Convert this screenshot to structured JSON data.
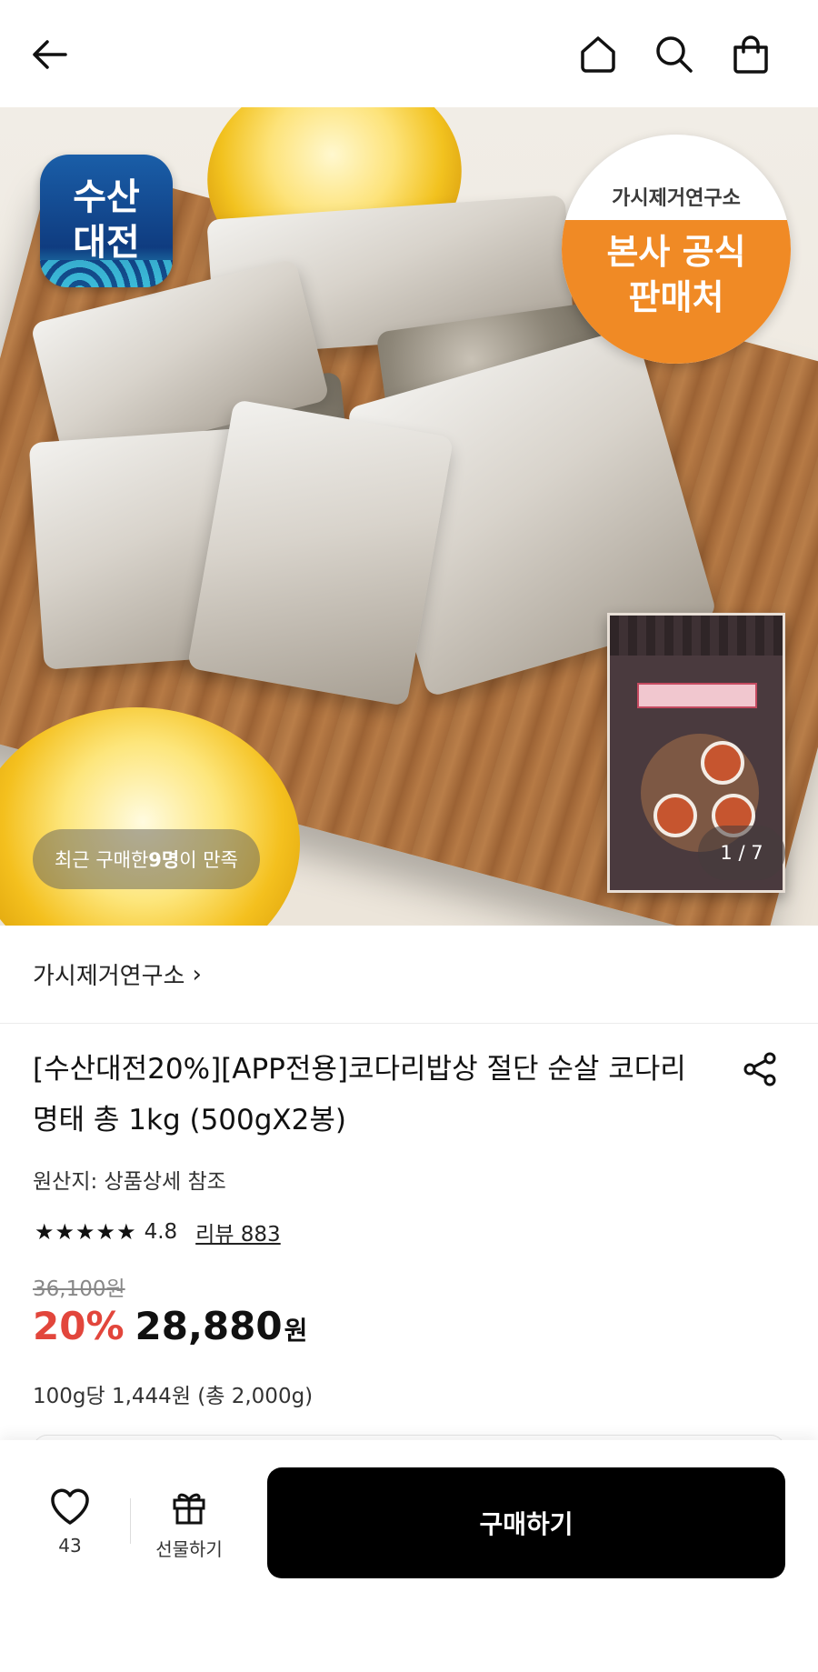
{
  "header": {
    "icons": [
      "back-arrow-icon",
      "home-icon",
      "search-icon",
      "shopping-bag-icon"
    ]
  },
  "hero": {
    "app_badge_line1": "수산",
    "app_badge_line2": "대전",
    "official_brand": "가시제거연구소",
    "official_line1": "본사 공식",
    "official_line2": "판매처",
    "buyers_prefix": "최근 구매한 ",
    "buyers_count": "9명",
    "buyers_suffix": "이 만족",
    "counter": "1 / 7"
  },
  "brand": {
    "name": "가시제거연구소",
    "chevron": "›"
  },
  "product": {
    "title": "[수산대전20%][APP전용]코다리밥상 절단 순살 코다리 명태 총 1kg (500gX2봉)",
    "origin": "원산지: 상품상세 참조",
    "rating": "4.8",
    "rating_stars": 4.8,
    "stars_glyph": "★★★★★",
    "review_label": "리뷰 883",
    "original_price": "36,100원",
    "discount": "20%",
    "price": "28,880",
    "currency": "원",
    "unit_price": "100g당 1,444원 (총 2,000g)"
  },
  "bottom_bar": {
    "wish_count": "43",
    "gift_label": "선물하기",
    "buy_label": "구매하기"
  },
  "colors": {
    "discount": "#e2463c",
    "buy_button": "#000000",
    "official_badge": "#f08a25",
    "app_badge": "#1a5ea8"
  }
}
